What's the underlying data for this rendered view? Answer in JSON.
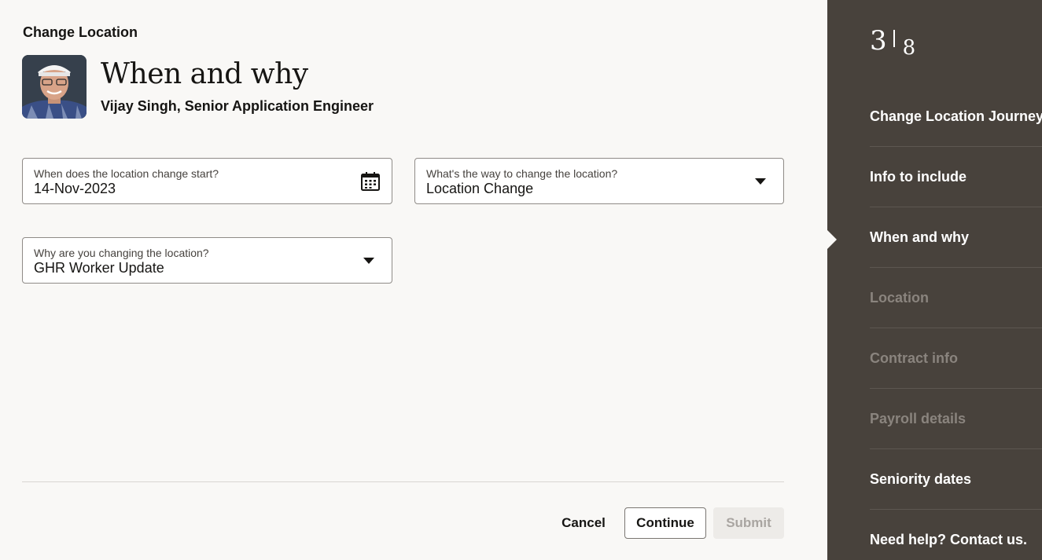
{
  "header": {
    "kicker": "Change Location",
    "title": "When and why",
    "subtitle": "Vijay Singh, Senior Application Engineer"
  },
  "form": {
    "start_date": {
      "label": "When does the location change start?",
      "value": "14-Nov-2023",
      "icon": "calendar-icon"
    },
    "way": {
      "label": "What's the way to change the location?",
      "value": "Location Change",
      "icon": "chevron-down-icon"
    },
    "reason": {
      "label": "Why are you changing the location?",
      "value": "GHR Worker Update",
      "icon": "chevron-down-icon"
    }
  },
  "footer": {
    "cancel_label": "Cancel",
    "continue_label": "Continue",
    "submit_label": "Submit"
  },
  "sidebar": {
    "step_current": "3",
    "step_total": "8",
    "items": [
      {
        "label": "Change Location Journey",
        "state": "enabled"
      },
      {
        "label": "Info to include",
        "state": "enabled"
      },
      {
        "label": "When and why",
        "state": "current"
      },
      {
        "label": "Location",
        "state": "disabled"
      },
      {
        "label": "Contract info",
        "state": "disabled"
      },
      {
        "label": "Payroll details",
        "state": "disabled"
      },
      {
        "label": "Seniority dates",
        "state": "enabled"
      },
      {
        "label": "Need help? Contact us.",
        "state": "enabled"
      }
    ]
  },
  "colors": {
    "sidebar_bg": "#48423c",
    "page_bg": "#f9f8f6",
    "disabled_text": "#8a847e"
  }
}
